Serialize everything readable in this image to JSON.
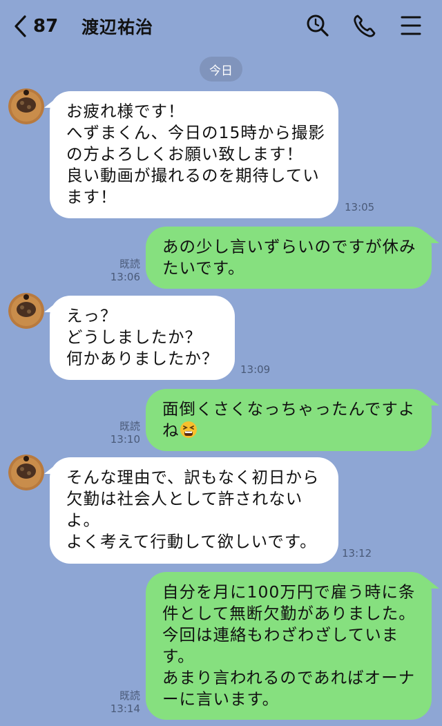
{
  "header": {
    "back_count": "87",
    "title": "渡辺祐治",
    "icons": [
      "chevron-left-icon",
      "search-icon",
      "phone-icon",
      "menu-icon"
    ]
  },
  "date_separator": "今日",
  "messages": [
    {
      "side": "in",
      "text": "お疲れ様です！\nへずまくん、今日の15時から撮影\nの方よろしくお願い致します！\n良い動画が撮れるのを期待してい\nます！",
      "time": "13:05"
    },
    {
      "side": "out",
      "text": "あの少し言いずらいのですが休み\nたいです。",
      "read": "既読",
      "time": "13:06"
    },
    {
      "side": "in",
      "text": "えっ？\nどうしましたか？\n何かありましたか？",
      "time": "13:09"
    },
    {
      "side": "out",
      "text": "面倒くさくなっちゃったんですよ\nね",
      "emoji": "tired-face-emoji",
      "read": "既読",
      "time": "13:10"
    },
    {
      "side": "in",
      "text": "そんな理由で、訳もなく初日から\n欠勤は社会人として許されない\nよ。\nよく考えて行動して欲しいです。",
      "time": "13:12"
    },
    {
      "side": "out",
      "text": "自分を月に100万円で雇う時に条\n件として無断欠勤がありました。\n今回は連絡もわざわざしていま\nす。\nあまり言われるのであればオーナ\nーに言います。",
      "read": "既読",
      "time": "13:14"
    }
  ],
  "colors": {
    "background": "#8ea6d4",
    "incoming_bubble": "#ffffff",
    "outgoing_bubble": "#86e07f",
    "date_pill": "#8094bc"
  }
}
